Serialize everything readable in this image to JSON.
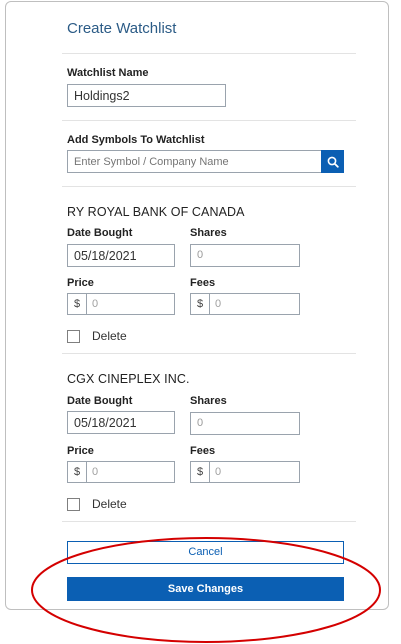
{
  "panel": {
    "title": "Create Watchlist",
    "watchlist_name_label": "Watchlist Name",
    "watchlist_name_value": "Holdings2",
    "add_symbols_label": "Add Symbols To Watchlist",
    "search_placeholder": "Enter Symbol / Company Name",
    "search_icon": "search-icon"
  },
  "holdings": [
    {
      "name": "RY ROYAL BANK OF CANADA",
      "date_label": "Date Bought",
      "date_value": "05/18/2021",
      "shares_label": "Shares",
      "shares_value": "0",
      "price_label": "Price",
      "price_prefix": "$",
      "price_value": "0",
      "fees_label": "Fees",
      "fees_prefix": "$",
      "fees_value": "0",
      "delete_label": "Delete"
    },
    {
      "name": "CGX CINEPLEX INC.",
      "date_label": "Date Bought",
      "date_value": "05/18/2021",
      "shares_label": "Shares",
      "shares_value": "0",
      "price_label": "Price",
      "price_prefix": "$",
      "price_value": "0",
      "fees_label": "Fees",
      "fees_prefix": "$",
      "fees_value": "0",
      "delete_label": "Delete"
    }
  ],
  "actions": {
    "cancel_label": "Cancel",
    "save_label": "Save Changes"
  },
  "colors": {
    "accent": "#0b5fb3",
    "title": "#2b5b86",
    "annotation": "#d40000"
  }
}
